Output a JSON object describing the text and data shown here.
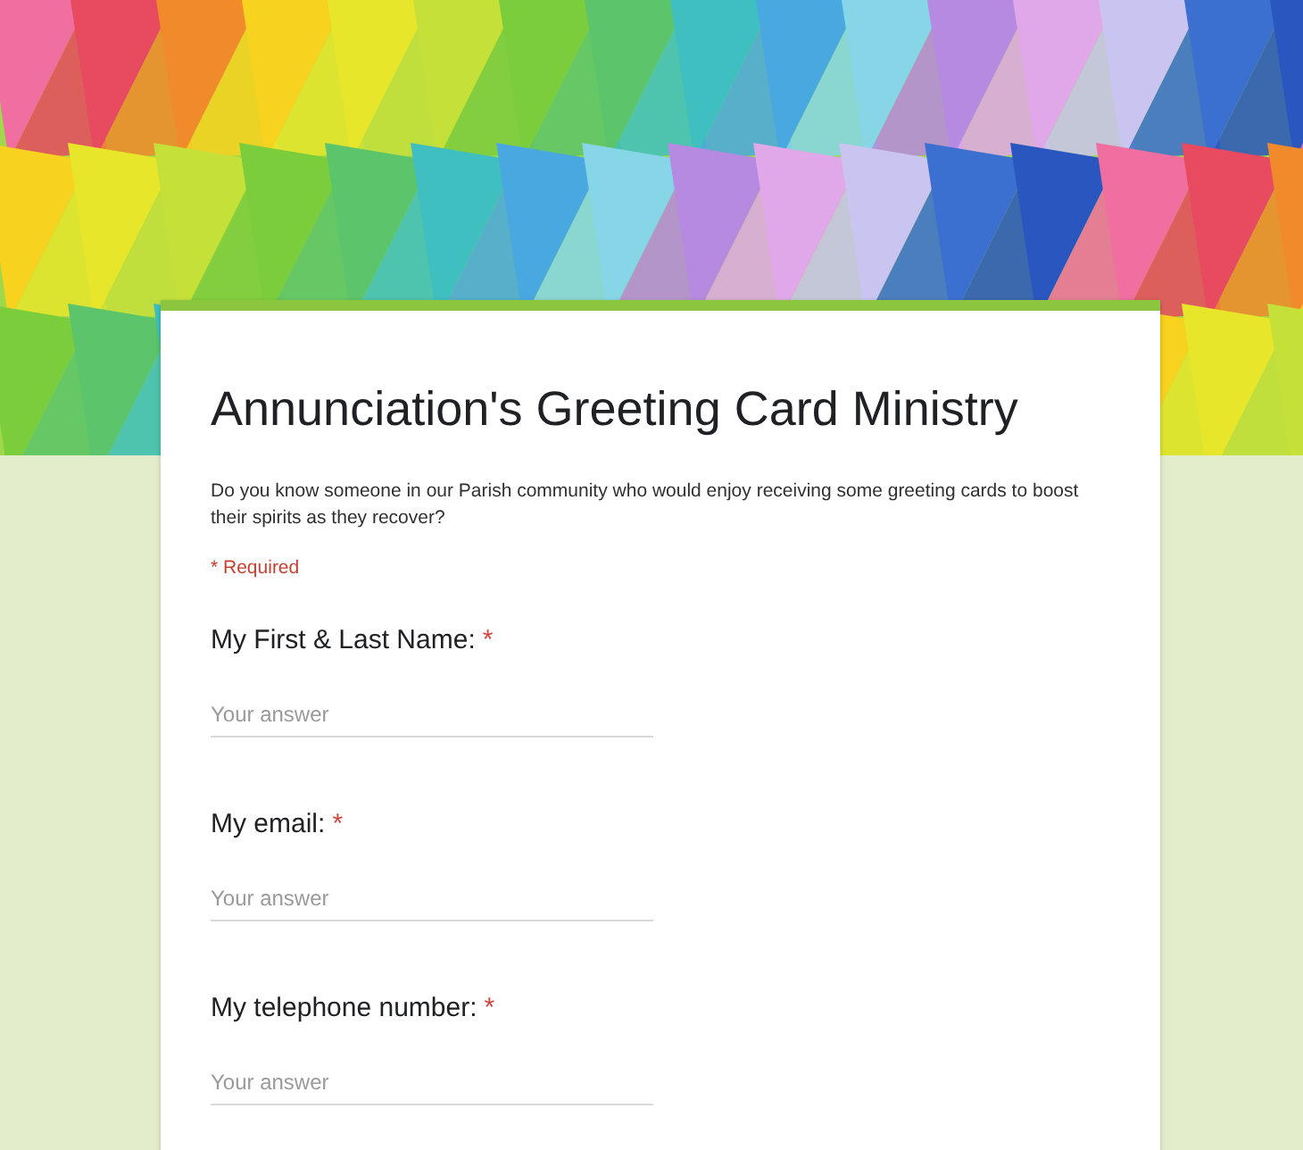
{
  "form": {
    "title": "Annunciation's Greeting Card Ministry",
    "description": "Do you know someone in our Parish community who would enjoy receiving some greeting cards to boost their spirits as they recover?",
    "required_note": "* Required",
    "questions": [
      {
        "label": "My First & Last Name:",
        "required_mark": "*",
        "placeholder": "Your answer"
      },
      {
        "label": "My email:",
        "required_mark": "*",
        "placeholder": "Your answer"
      },
      {
        "label": "My telephone number:",
        "required_mark": "*",
        "placeholder": "Your answer"
      }
    ]
  }
}
